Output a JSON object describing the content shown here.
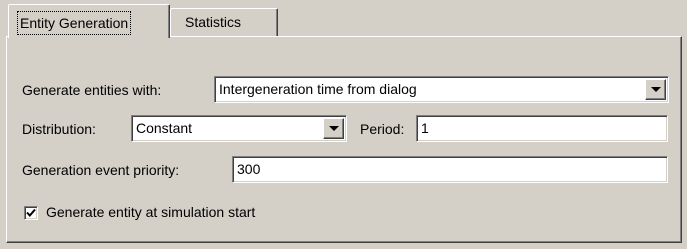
{
  "tabs": [
    {
      "label": "Entity Generation"
    },
    {
      "label": "Statistics"
    }
  ],
  "form": {
    "generate_label": "Generate entities with:",
    "generate_value": "Intergeneration time from dialog",
    "distribution_label": "Distribution:",
    "distribution_value": "Constant",
    "period_label": "Period:",
    "period_value": "1",
    "priority_label": "Generation event priority:",
    "priority_value": "300",
    "start_label": "Generate entity at simulation start",
    "start_checked": true
  },
  "icons": {
    "dropdown": "chevron-down-icon",
    "check": "checkmark-icon"
  },
  "colors": {
    "face": "#d4d0c8",
    "field": "#ffffff"
  }
}
